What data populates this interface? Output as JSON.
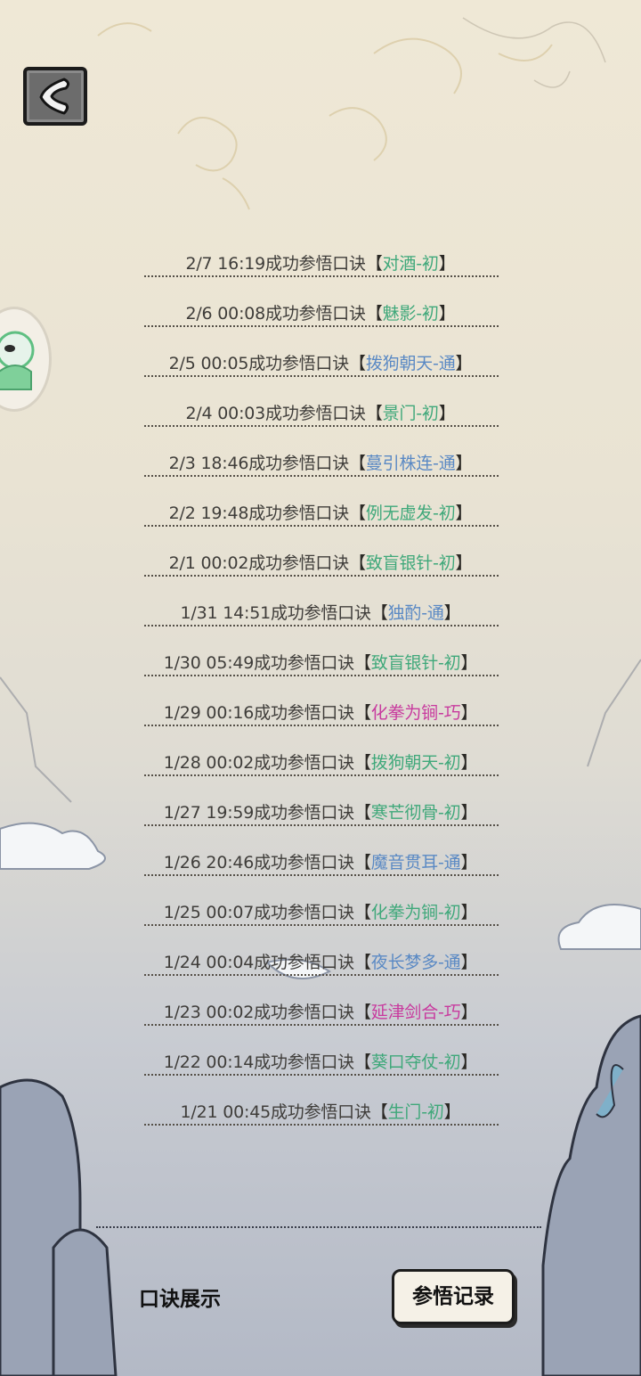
{
  "nav": {
    "back_icon": "chevron-left-icon",
    "avatar_icon": "green-creature-icon"
  },
  "records": [
    {
      "prefix": "2/7 16:19成功参悟口诀",
      "name": "对酒-初",
      "tier_color": "green"
    },
    {
      "prefix": "2/6 00:08成功参悟口诀",
      "name": "魅影-初",
      "tier_color": "green"
    },
    {
      "prefix": "2/5 00:05成功参悟口诀",
      "name": "拨狗朝天-通",
      "tier_color": "blue"
    },
    {
      "prefix": "2/4 00:03成功参悟口诀",
      "name": "景门-初",
      "tier_color": "green"
    },
    {
      "prefix": "2/3 18:46成功参悟口诀",
      "name": "蔓引株连-通",
      "tier_color": "blue"
    },
    {
      "prefix": "2/2 19:48成功参悟口诀",
      "name": "例无虚发-初",
      "tier_color": "green"
    },
    {
      "prefix": "2/1 00:02成功参悟口诀",
      "name": "致盲银针-初",
      "tier_color": "green"
    },
    {
      "prefix": "1/31 14:51成功参悟口诀",
      "name": "独酌-通",
      "tier_color": "blue"
    },
    {
      "prefix": "1/30 05:49成功参悟口诀",
      "name": "致盲银针-初",
      "tier_color": "green"
    },
    {
      "prefix": "1/29 00:16成功参悟口诀",
      "name": "化拳为锏-巧",
      "tier_color": "magenta"
    },
    {
      "prefix": "1/28 00:02成功参悟口诀",
      "name": "拨狗朝天-初",
      "tier_color": "green"
    },
    {
      "prefix": "1/27 19:59成功参悟口诀",
      "name": "寒芒彻骨-初",
      "tier_color": "green"
    },
    {
      "prefix": "1/26 20:46成功参悟口诀",
      "name": "魔音贯耳-通",
      "tier_color": "blue"
    },
    {
      "prefix": "1/25 00:07成功参悟口诀",
      "name": "化拳为锏-初",
      "tier_color": "green"
    },
    {
      "prefix": "1/24 00:04成功参悟口诀",
      "name": "夜长梦多-通",
      "tier_color": "blue"
    },
    {
      "prefix": "1/23 00:02成功参悟口诀",
      "name": "延津剑合-巧",
      "tier_color": "magenta"
    },
    {
      "prefix": "1/22 00:14成功参悟口诀",
      "name": "葵口夺仗-初",
      "tier_color": "green"
    },
    {
      "prefix": "1/21 00:45成功参悟口诀",
      "name": "生门-初",
      "tier_color": "green"
    }
  ],
  "brackets": {
    "open": "【",
    "close": "】"
  },
  "tabs": {
    "display_label": "口诀展示",
    "record_label": "参悟记录"
  },
  "colors": {
    "green": "#3fa87a",
    "blue": "#5a89c4",
    "magenta": "#c83a9e"
  }
}
